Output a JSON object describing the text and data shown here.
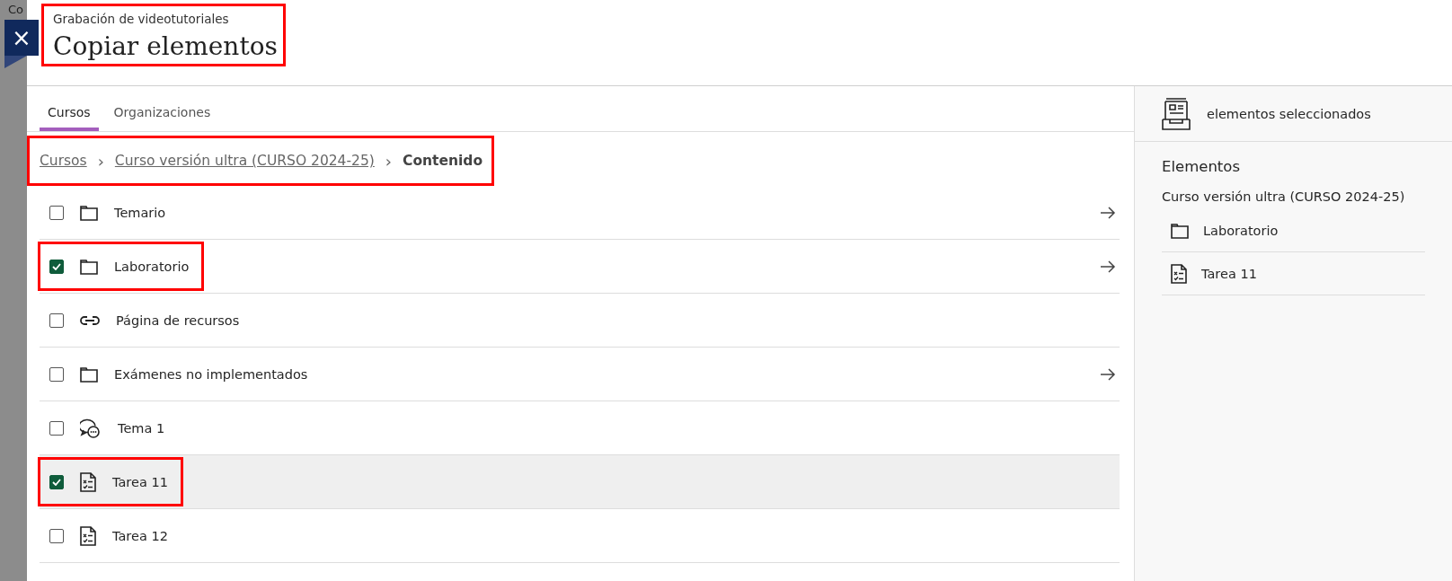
{
  "background_page": {
    "text": "Co"
  },
  "close_button": {
    "label": "×"
  },
  "header": {
    "subtitle": "Grabación de videotutoriales",
    "title": "Copiar elementos",
    "highlighted": true
  },
  "tabs": [
    {
      "label": "Cursos",
      "selected": true
    },
    {
      "label": "Organizaciones",
      "selected": false
    }
  ],
  "breadcrumb": {
    "highlighted": true,
    "links": [
      "Cursos",
      "Curso versión ultra (CURSO 2024-25)"
    ],
    "separator": "›",
    "current": "Contenido"
  },
  "items": [
    {
      "label": "Temario",
      "kind": "folder",
      "checked": false,
      "navigable": true,
      "hovered": false,
      "highlighted": false
    },
    {
      "label": "Laboratorio",
      "kind": "folder",
      "checked": true,
      "navigable": true,
      "hovered": false,
      "highlighted": true
    },
    {
      "label": "Página de recursos",
      "kind": "link",
      "checked": false,
      "navigable": false,
      "hovered": false,
      "highlighted": false
    },
    {
      "label": "Exámenes no implementados",
      "kind": "folder",
      "checked": false,
      "navigable": true,
      "hovered": false,
      "highlighted": false
    },
    {
      "label": "Tema 1",
      "kind": "discussion",
      "checked": false,
      "navigable": false,
      "hovered": false,
      "highlighted": false
    },
    {
      "label": "Tarea 11",
      "kind": "assignment",
      "checked": true,
      "navigable": false,
      "hovered": true,
      "highlighted": true
    },
    {
      "label": "Tarea 12",
      "kind": "assignment",
      "checked": false,
      "navigable": false,
      "hovered": false,
      "highlighted": false
    }
  ],
  "selection_panel": {
    "header": "elementos seleccionados",
    "section_title": "Elementos",
    "course": "Curso versión ultra (CURSO 2024-25)",
    "items": [
      {
        "label": "Laboratorio",
        "kind": "folder"
      },
      {
        "label": "Tarea 11",
        "kind": "assignment"
      }
    ]
  }
}
